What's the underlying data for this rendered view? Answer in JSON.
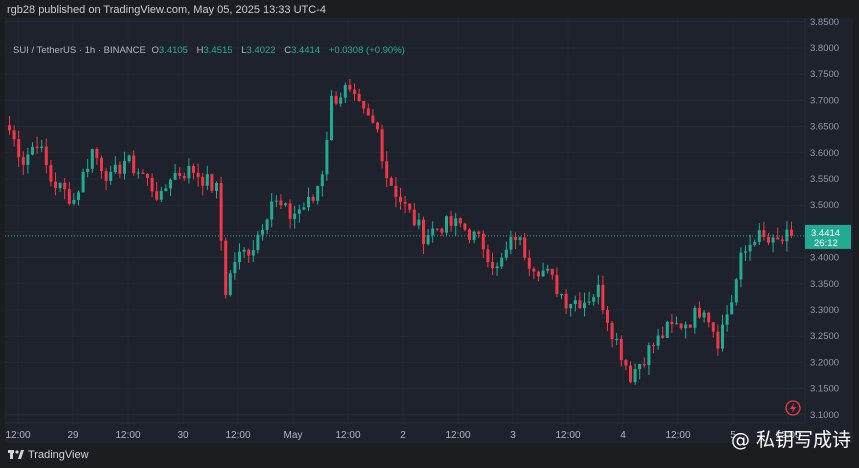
{
  "publisher_line": "rgb28 published on TradingView.com, May 05, 2025 13:33 UTC-4",
  "legend": {
    "symbol": "SUI / TetherUS · 1h · BINANCE",
    "o_label": "O",
    "o": "3.4105",
    "h_label": "H",
    "h": "3.4515",
    "l_label": "L",
    "l": "3.4022",
    "c_label": "C",
    "c": "3.4414",
    "change": "+0.0308 (+0.90%)"
  },
  "last_price": {
    "price": "3.4414",
    "countdown": "26:12"
  },
  "footer": {
    "brand": "TradingView",
    "watermark": "@ 私钥写成诗"
  },
  "colors": {
    "up": "#22ab94",
    "down": "#f23645",
    "background": "#1e222d",
    "grid": "#2a2e39"
  },
  "chart_data": {
    "type": "candlestick",
    "title": "SUI / TetherUS · 1h · BINANCE",
    "interval": "1h",
    "ylim": [
      3.08,
      3.86
    ],
    "y_ticks": [
      "3.8500",
      "3.8000",
      "3.7500",
      "3.7000",
      "3.6500",
      "3.6000",
      "3.5500",
      "3.5000",
      "3.4500",
      "3.4000",
      "3.3500",
      "3.3000",
      "3.2500",
      "3.2000",
      "3.1500",
      "3.1000"
    ],
    "x_ticks": [
      "12:00",
      "29",
      "12:00",
      "30",
      "12:00",
      "May",
      "12:00",
      "2",
      "12:00",
      "3",
      "12:00",
      "4",
      "12:00",
      "5",
      "12:00"
    ],
    "candle_count": 171,
    "close_keypoints": [
      [
        0,
        3.643
      ],
      [
        3,
        3.586
      ],
      [
        6,
        3.624
      ],
      [
        9,
        3.548
      ],
      [
        14,
        3.51
      ],
      [
        18,
        3.605
      ],
      [
        22,
        3.548
      ],
      [
        25,
        3.586
      ],
      [
        29,
        3.558
      ],
      [
        33,
        3.51
      ],
      [
        35,
        3.558
      ],
      [
        40,
        3.567
      ],
      [
        45,
        3.529
      ],
      [
        47,
        3.338
      ],
      [
        49,
        3.395
      ],
      [
        53,
        3.424
      ],
      [
        57,
        3.51
      ],
      [
        61,
        3.48
      ],
      [
        66,
        3.51
      ],
      [
        68,
        3.567
      ],
      [
        70,
        3.7
      ],
      [
        73,
        3.72
      ],
      [
        77,
        3.672
      ],
      [
        80,
        3.643
      ],
      [
        82,
        3.558
      ],
      [
        85,
        3.51
      ],
      [
        90,
        3.443
      ],
      [
        94,
        3.462
      ],
      [
        98,
        3.462
      ],
      [
        103,
        3.424
      ],
      [
        106,
        3.376
      ],
      [
        110,
        3.443
      ],
      [
        113,
        3.395
      ],
      [
        117,
        3.367
      ],
      [
        121,
        3.319
      ],
      [
        125,
        3.319
      ],
      [
        128,
        3.338
      ],
      [
        131,
        3.262
      ],
      [
        135,
        3.176
      ],
      [
        139,
        3.224
      ],
      [
        143,
        3.262
      ],
      [
        148,
        3.281
      ],
      [
        151,
        3.31
      ],
      [
        154,
        3.243
      ],
      [
        157,
        3.319
      ],
      [
        159,
        3.395
      ],
      [
        162,
        3.443
      ],
      [
        166,
        3.424
      ],
      [
        170,
        3.4414
      ]
    ]
  }
}
